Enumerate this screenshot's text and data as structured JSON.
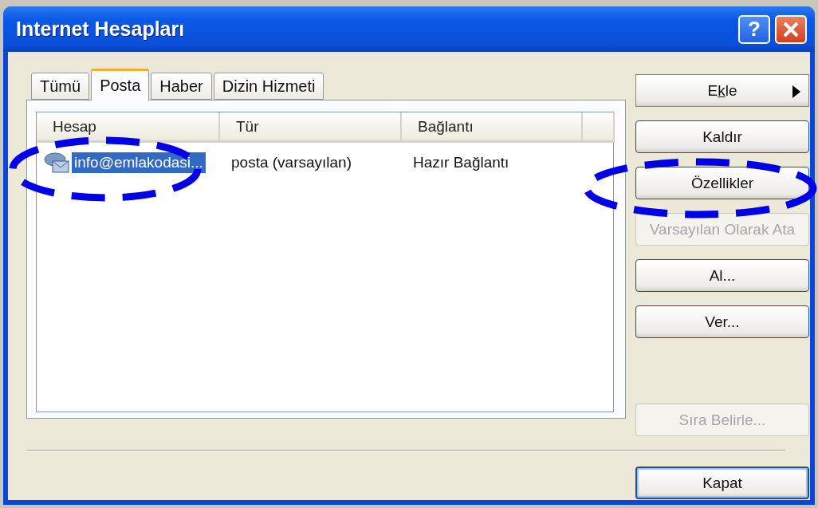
{
  "window": {
    "title": "Internet Hesapları",
    "help_label": "?"
  },
  "tabs": [
    {
      "label": "Tümü",
      "selected": false
    },
    {
      "label": "Posta",
      "selected": true
    },
    {
      "label": "Haber",
      "selected": false
    },
    {
      "label": "Dizin Hizmeti",
      "selected": false
    }
  ],
  "list": {
    "columns": [
      "Hesap",
      "Tür",
      "Bağlantı"
    ],
    "rows": [
      {
        "selected": true,
        "cells": [
          "info@emlakodasi...",
          "posta (varsayılan)",
          "Hazır Bağlantı"
        ]
      }
    ]
  },
  "side_buttons": [
    {
      "kind": "menu",
      "label_before": "E",
      "access_key": "k",
      "label_after": "le",
      "disabled": false
    },
    {
      "label": "Kaldır",
      "kind": "normal",
      "disabled": false
    },
    {
      "label": "Özellikler",
      "kind": "normal",
      "disabled": false
    },
    {
      "label": "Varsayılan Olarak Ata",
      "kind": "normal",
      "disabled": true
    },
    {
      "label": "Al...",
      "kind": "normal",
      "disabled": false
    },
    {
      "label": "Ver...",
      "kind": "normal",
      "disabled": false
    }
  ],
  "order_button": {
    "label": "Sıra Belirle...",
    "disabled": true
  },
  "close_button": {
    "label": "Kapat",
    "default": true
  },
  "annotations": [
    {
      "kind": "dashed-ellipse"
    },
    {
      "kind": "dashed-ellipse"
    }
  ]
}
